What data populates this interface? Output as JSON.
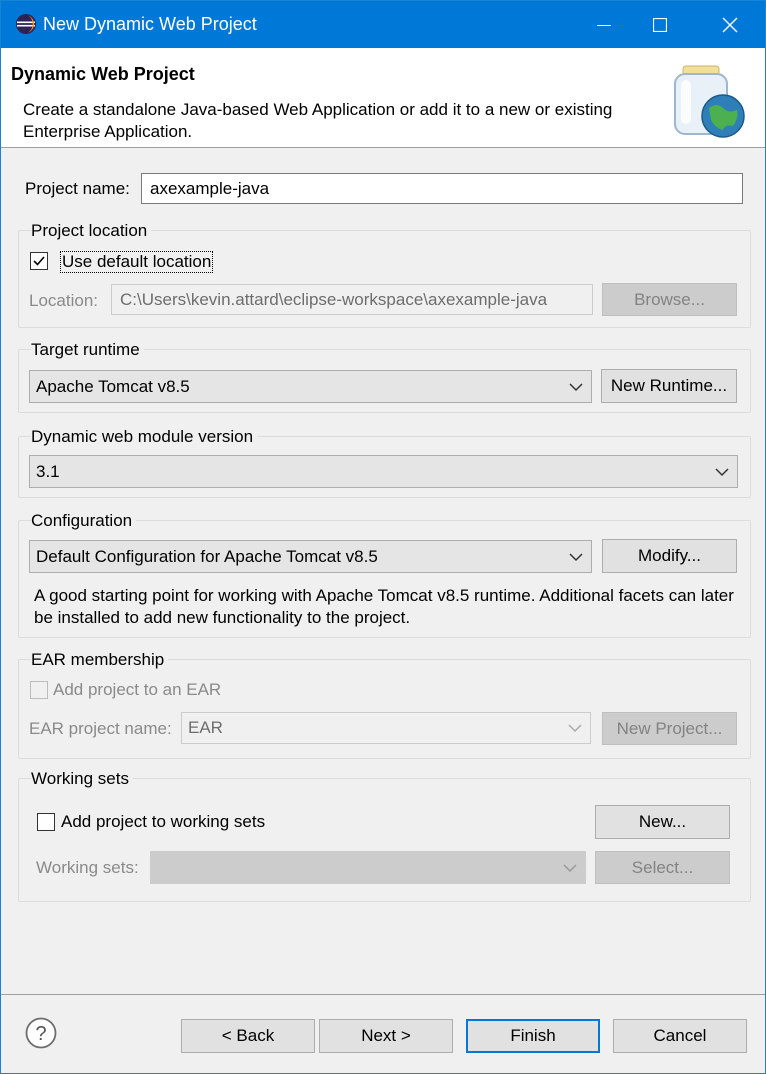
{
  "window": {
    "title": "New Dynamic Web Project"
  },
  "banner": {
    "heading": "Dynamic Web Project",
    "description": "Create a standalone Java-based Web Application or add it to a new or existing Enterprise Application."
  },
  "project": {
    "name_label": "Project name:",
    "name_value": "axexample-java"
  },
  "location": {
    "group_label": "Project location",
    "use_default_label": "Use default location",
    "use_default_checked": true,
    "location_label": "Location:",
    "location_value": "C:\\Users\\kevin.attard\\eclipse-workspace\\axexample-java",
    "browse_label": "Browse..."
  },
  "runtime": {
    "group_label": "Target runtime",
    "selected": "Apache Tomcat v8.5",
    "new_runtime_label": "New Runtime..."
  },
  "module": {
    "group_label": "Dynamic web module version",
    "selected": "3.1"
  },
  "configuration": {
    "group_label": "Configuration",
    "selected": "Default Configuration for Apache Tomcat v8.5",
    "modify_label": "Modify...",
    "description": "A good starting point for working with Apache Tomcat v8.5 runtime. Additional facets can later be installed to add new functionality to the project."
  },
  "ear": {
    "group_label": "EAR membership",
    "add_label": "Add project to an EAR",
    "name_label": "EAR project name:",
    "name_value": "EAR",
    "new_project_label": "New Project..."
  },
  "working_sets": {
    "group_label": "Working sets",
    "add_label": "Add project to working sets",
    "new_label": "New...",
    "sets_label": "Working sets:",
    "select_label": "Select..."
  },
  "footer": {
    "back_label": "< Back",
    "next_label": "Next >",
    "finish_label": "Finish",
    "cancel_label": "Cancel"
  },
  "icons": {
    "app": "eclipse-icon",
    "help": "help-icon",
    "wizard": "web-project-jar-globe-icon"
  },
  "colors": {
    "titlebar": "#0078d7",
    "default_button_border": "#0078d7"
  }
}
